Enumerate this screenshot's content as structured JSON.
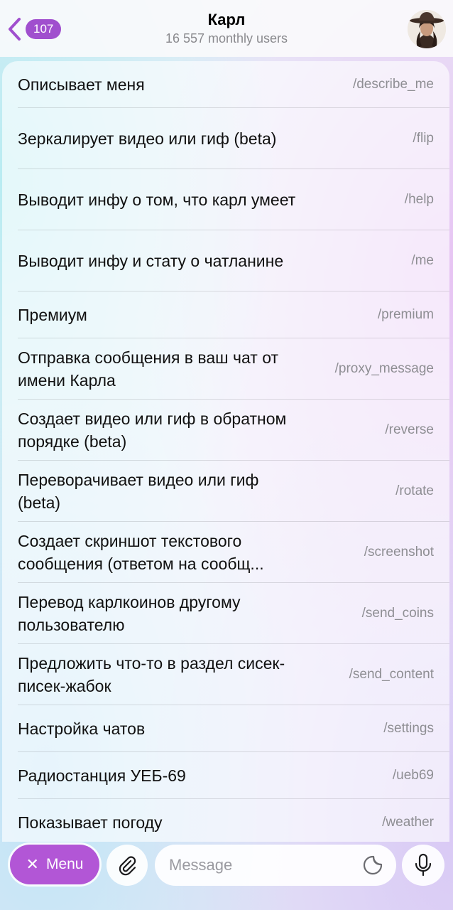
{
  "header": {
    "back_count": "107",
    "title": "Карл",
    "subtitle": "16 557 monthly users"
  },
  "commands": [
    {
      "desc": "Описывает меня",
      "cmd": "/describe_me"
    },
    {
      "desc": "Зеркалирует видео или гиф (beta)",
      "cmd": "/flip"
    },
    {
      "desc": "Выводит инфу о том, что карл умеет",
      "cmd": "/help"
    },
    {
      "desc": "Выводит инфу и стату о чатланине",
      "cmd": "/me"
    },
    {
      "desc": "Премиум",
      "cmd": "/premium"
    },
    {
      "desc": "Отправка сообщения в ваш чат от имени Карла",
      "cmd": "/proxy_message"
    },
    {
      "desc": "Создает видео или гиф в обратном порядке (beta)",
      "cmd": "/reverse"
    },
    {
      "desc": "Переворачивает видео или гиф (beta)",
      "cmd": "/rotate"
    },
    {
      "desc": "Создает скриншот текстового сообщения (ответом на сообщ...",
      "cmd": "/screenshot"
    },
    {
      "desc": "Перевод карлкоинов другому пользователю",
      "cmd": "/send_coins"
    },
    {
      "desc": "Предложить что-то в раздел сисек-писек-жабок",
      "cmd": "/send_content"
    },
    {
      "desc": "Настройка чатов",
      "cmd": "/settings"
    },
    {
      "desc": "Радиостанция УЕБ-69",
      "cmd": "/ueb69"
    },
    {
      "desc": "Показывает погоду",
      "cmd": "/weather"
    }
  ],
  "composer": {
    "menu_label": "Menu",
    "message_placeholder": "Message"
  },
  "colors": {
    "accent": "#a04fce",
    "menu_button": "#b256d6"
  },
  "icons": [
    "chevron-left-icon",
    "close-icon",
    "paperclip-icon",
    "sticker-icon",
    "microphone-icon"
  ]
}
